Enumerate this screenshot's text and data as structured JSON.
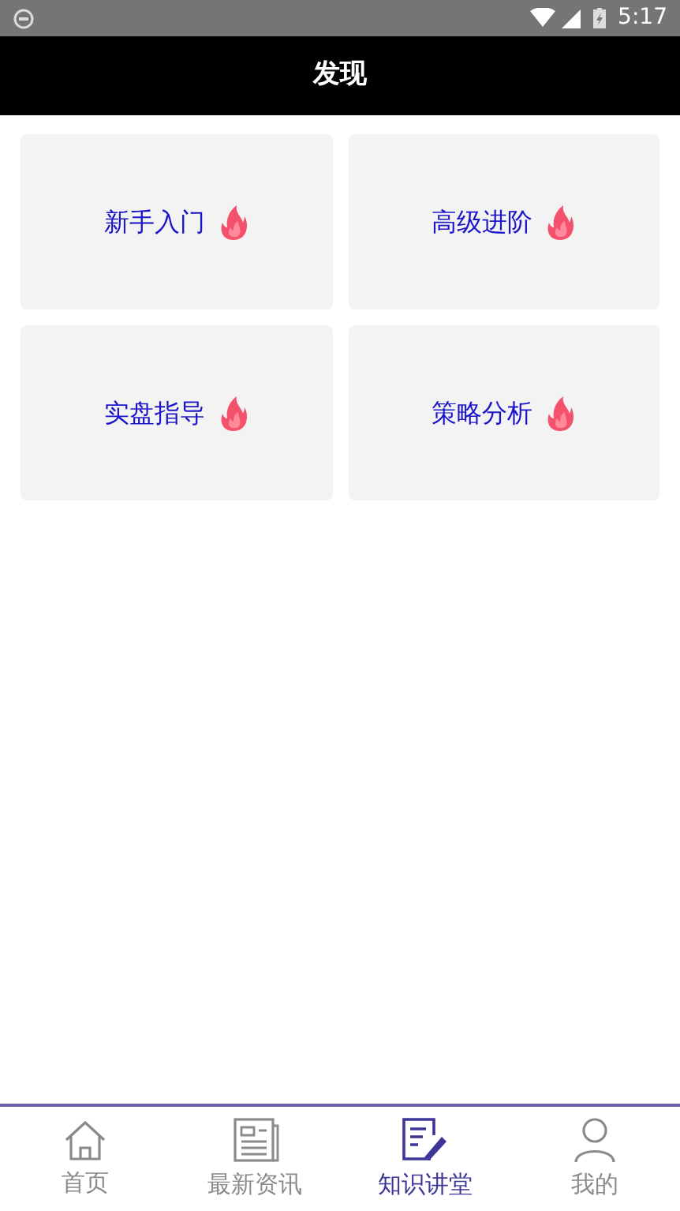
{
  "status_bar": {
    "time": "5:17"
  },
  "header": {
    "title": "发现"
  },
  "cards": [
    {
      "label": "新手入门"
    },
    {
      "label": "高级进阶"
    },
    {
      "label": "实盘指导"
    },
    {
      "label": "策略分析"
    }
  ],
  "tab_bar": [
    {
      "label": "首页",
      "kind": "home",
      "selected": false
    },
    {
      "label": "最新资讯",
      "kind": "news",
      "selected": false
    },
    {
      "label": "知识讲堂",
      "kind": "lesson",
      "selected": true
    },
    {
      "label": "我的",
      "kind": "profile",
      "selected": false
    }
  ]
}
